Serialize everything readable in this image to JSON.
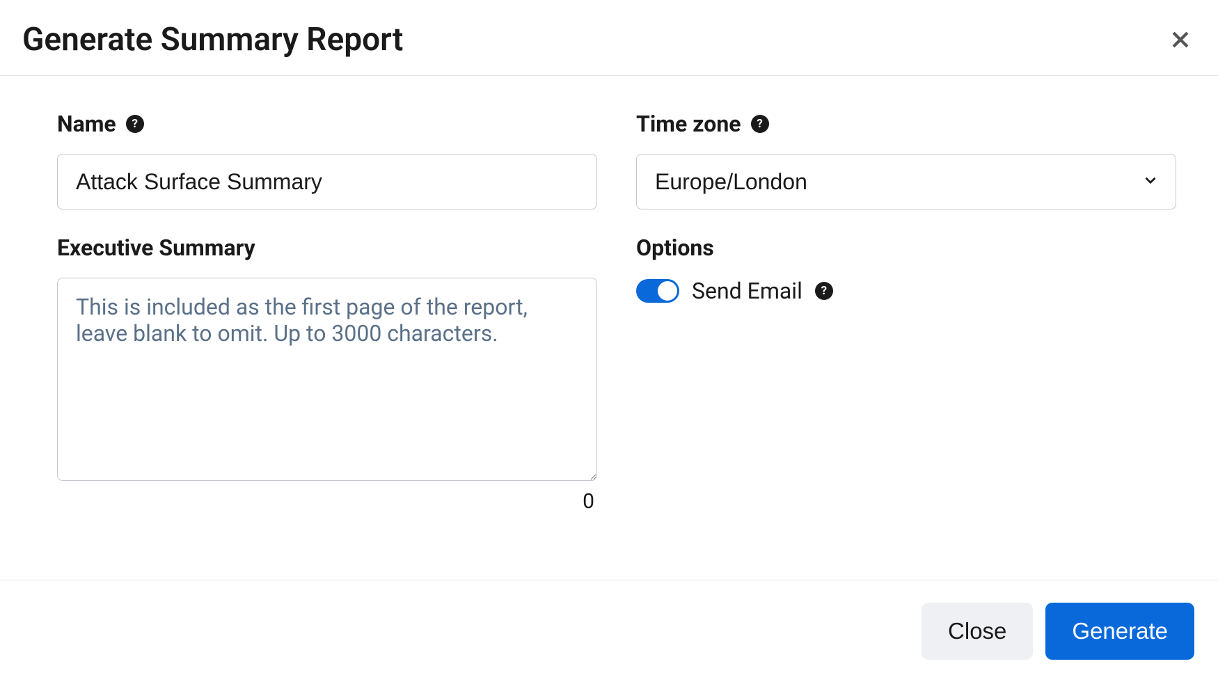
{
  "dialog": {
    "title": "Generate Summary Report"
  },
  "fields": {
    "name": {
      "label": "Name",
      "value": "Attack Surface Summary"
    },
    "timezone": {
      "label": "Time zone",
      "value": "Europe/London"
    },
    "executive_summary": {
      "label": "Executive Summary",
      "placeholder": "This is included as the first page of the report, leave blank to omit. Up to 3000 characters.",
      "value": "",
      "char_count": "0"
    },
    "options": {
      "label": "Options",
      "send_email": {
        "label": "Send Email",
        "enabled": true
      }
    }
  },
  "footer": {
    "close": "Close",
    "generate": "Generate"
  }
}
